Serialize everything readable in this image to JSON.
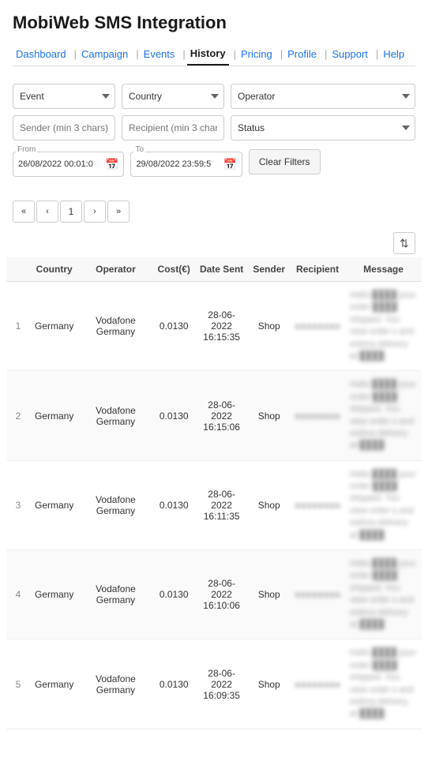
{
  "app": {
    "title": "MobiWeb SMS Integration"
  },
  "nav": {
    "items": [
      {
        "label": "Dashboard",
        "active": false
      },
      {
        "label": "Campaign",
        "active": false
      },
      {
        "label": "Events",
        "active": false
      },
      {
        "label": "History",
        "active": true
      },
      {
        "label": "Pricing",
        "active": false
      },
      {
        "label": "Profile",
        "active": false
      },
      {
        "label": "Support",
        "active": false
      },
      {
        "label": "Help",
        "active": false
      }
    ]
  },
  "filters": {
    "event_placeholder": "Event",
    "country_placeholder": "Country",
    "operator_placeholder": "Operator",
    "sender_placeholder": "Sender (min 3 chars)",
    "recipient_placeholder": "Recipient (min 3 chars)",
    "status_placeholder": "Status",
    "date_from_label": "From",
    "date_from_value": "26/08/2022 00:01:0",
    "date_to_label": "To",
    "date_to_value": "29/08/2022 23:59:5",
    "clear_label": "Clear Filters"
  },
  "pagination": {
    "first": "«",
    "prev": "‹",
    "page": "1",
    "next": "›",
    "last": "»"
  },
  "table": {
    "columns": [
      "",
      "Country",
      "Operator",
      "Cost(€)",
      "Date Sent",
      "Sender",
      "Recipient",
      "Message"
    ],
    "sort_icon": "⇅",
    "rows": [
      {
        "num": "1",
        "country": "Germany",
        "operator": "Vodafone Germany",
        "cost": "0.0130",
        "date": "28-06-2022 16:15:35",
        "sender": "Shop",
        "recipient": "██████████",
        "message": "Hello ██████ your order ████ shipped. You view order s and estima delivery at ██████████"
      },
      {
        "num": "2",
        "country": "Germany",
        "operator": "Vodafone Germany",
        "cost": "0.0130",
        "date": "28-06-2022 16:15:06",
        "sender": "Shop",
        "recipient": "██████████",
        "message": "Hello ████████ thank you fo order ████. Y view order s and estima delivery at ██████████"
      },
      {
        "num": "3",
        "country": "Germany",
        "operator": "Vodafone Germany",
        "cost": "0.0130",
        "date": "28-06-2022 16:11:35",
        "sender": "Shop",
        "recipient": "██████████",
        "message": "Hello ████████ order ████ shipped. You view order s and estima delivery at ██████████"
      },
      {
        "num": "4",
        "country": "Germany",
        "operator": "Vodafone Germany",
        "cost": "0.0130",
        "date": "28-06-2022 16:10:06",
        "sender": "Shop",
        "recipient": "██████████",
        "message": "Hello ████████ thank you fo order ████. Y view order s and estima delivery at ██████████"
      },
      {
        "num": "5",
        "country": "Germany",
        "operator": "Vodafone Germany",
        "cost": "0.0130",
        "date": "28-06-2022 16:09:35",
        "sender": "Shop",
        "recipient": "██████████",
        "message": "Hello ████████ order ████ shipped. You view order s and estima delivery at ██████████"
      }
    ]
  }
}
